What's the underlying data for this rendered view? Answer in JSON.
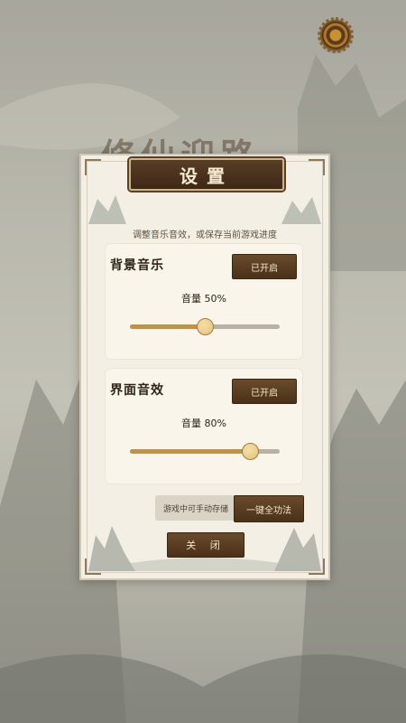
{
  "background": {
    "game_title": "修仙迎路"
  },
  "icons": {
    "settings": "gear-icon"
  },
  "settings_dialog": {
    "title": "设置",
    "subtitle": "调整音乐音效，或保存当前游戏进度",
    "music": {
      "label": "背景音乐",
      "toggle_label": "已开启",
      "volume_text": "音量 50%",
      "volume": 0.5
    },
    "sfx": {
      "label": "界面音效",
      "toggle_label": "已开启",
      "volume_text": "音量 80%",
      "volume": 0.8
    },
    "save_hint": "游戏中可手动存储",
    "oneclick_label": "一键全功法",
    "close_label": "关 闭"
  },
  "colors": {
    "accent_brown": "#4a3119",
    "slider_fill": "#c9903a",
    "panel_bg": "#f3efe4"
  }
}
